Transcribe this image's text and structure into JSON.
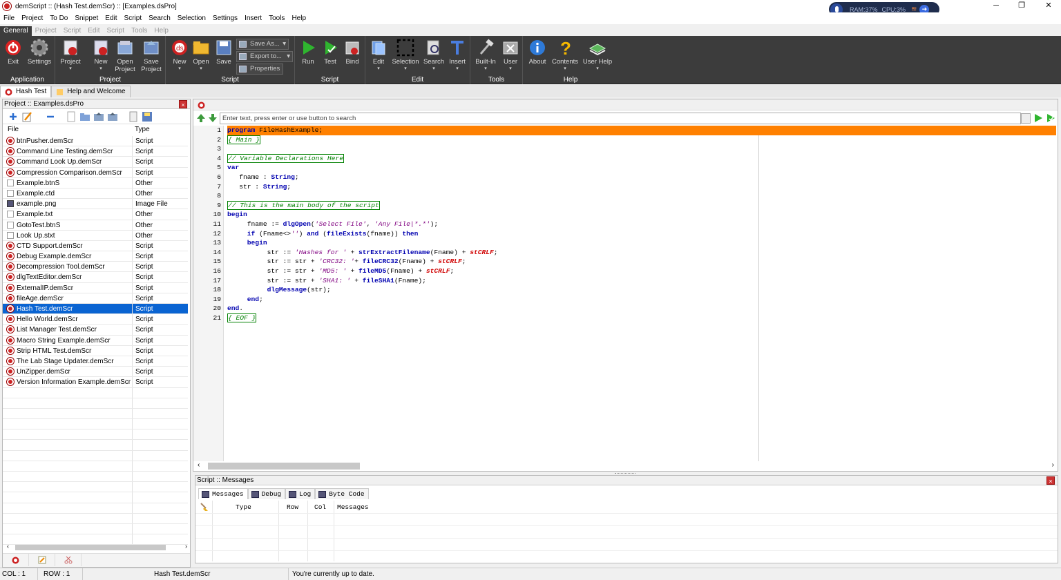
{
  "window": {
    "title": "demScript :: (Hash Test.demScr) :: [Examples.dsPro]",
    "minimize": "─",
    "maximize": "❐",
    "close": "✕"
  },
  "system_monitor": {
    "ram": "RAM:37%",
    "cpu": "CPU:3%"
  },
  "menu": [
    "File",
    "Project",
    "To Do",
    "Snippet",
    "Edit",
    "Script",
    "Search",
    "Selection",
    "Settings",
    "Insert",
    "Tools",
    "Help"
  ],
  "ribbon_tabs": [
    "General",
    "Project",
    "Script",
    "Edit",
    "Script",
    "Tools",
    "Help"
  ],
  "ribbon": {
    "application": {
      "label": "Application",
      "exit": "Exit",
      "settings": "Settings"
    },
    "project": {
      "label": "Project",
      "project": "Project"
    },
    "new": "New",
    "open_project_1": "Open",
    "open_project_2": "Project",
    "save_project_1": "Save",
    "save_project_2": "Project",
    "script": {
      "label": "Script",
      "new": "New",
      "open": "Open",
      "save": "Save",
      "save_as": "Save As...",
      "export": "Export to...",
      "properties": "Properties"
    },
    "script2": {
      "label": "Script",
      "run": "Run",
      "test": "Test",
      "bind": "Bind"
    },
    "edit": {
      "label": "Edit",
      "edit": "Edit",
      "selection": "Selection",
      "search": "Search",
      "insert": "Insert"
    },
    "tools": {
      "label": "Tools",
      "builtin": "Built-In",
      "user": "User"
    },
    "help": {
      "label": "Help",
      "about": "About",
      "contents": "Contents",
      "user_help": "User Help"
    }
  },
  "doc_tabs": [
    "Hash Test",
    "Help and Welcome"
  ],
  "project_panel": {
    "title": "Project :: Examples.dsPro",
    "columns": [
      "File",
      "Type"
    ],
    "files": [
      {
        "name": "btnPusher.demScr",
        "type": "Script",
        "icon": "script"
      },
      {
        "name": "Command Line Testing.demScr",
        "type": "Script",
        "icon": "script"
      },
      {
        "name": "Command Look Up.demScr",
        "type": "Script",
        "icon": "script"
      },
      {
        "name": "Compression Comparison.demScr",
        "type": "Script",
        "icon": "script"
      },
      {
        "name": "Example.btnS",
        "type": "Other",
        "icon": "other"
      },
      {
        "name": "Example.ctd",
        "type": "Other",
        "icon": "other"
      },
      {
        "name": "example.png",
        "type": "Image File",
        "icon": "image"
      },
      {
        "name": "Example.txt",
        "type": "Other",
        "icon": "other"
      },
      {
        "name": "GotoTest.btnS",
        "type": "Other",
        "icon": "other"
      },
      {
        "name": "Look Up.stxt",
        "type": "Other",
        "icon": "other"
      },
      {
        "name": "CTD Support.demScr",
        "type": "Script",
        "icon": "script"
      },
      {
        "name": "Debug Example.demScr",
        "type": "Script",
        "icon": "script"
      },
      {
        "name": "Decompression Tool.demScr",
        "type": "Script",
        "icon": "script"
      },
      {
        "name": "dlgTextEditor.demScr",
        "type": "Script",
        "icon": "script"
      },
      {
        "name": "ExternalIP.demScr",
        "type": "Script",
        "icon": "script"
      },
      {
        "name": "fileAge.demScr",
        "type": "Script",
        "icon": "script"
      },
      {
        "name": "Hash Test.demScr",
        "type": "Script",
        "icon": "script",
        "selected": true
      },
      {
        "name": "Hello World.demScr",
        "type": "Script",
        "icon": "script"
      },
      {
        "name": "List Manager Test.demScr",
        "type": "Script",
        "icon": "script"
      },
      {
        "name": "Macro String Example.demScr",
        "type": "Script",
        "icon": "script"
      },
      {
        "name": "Strip HTML Test.demScr",
        "type": "Script",
        "icon": "script"
      },
      {
        "name": "The Lab Stage Updater.demScr",
        "type": "Script",
        "icon": "script"
      },
      {
        "name": "UnZipper.demScr",
        "type": "Script",
        "icon": "script"
      },
      {
        "name": "Version Information Example.demScr",
        "type": "Script",
        "icon": "script"
      }
    ]
  },
  "editor": {
    "search_placeholder": "Enter text, press enter or use button to search",
    "lines": [
      [
        [
          "kw",
          "program"
        ],
        [
          "t",
          " FileHashExample;"
        ]
      ],
      [
        [
          "cm",
          "{ Main }"
        ]
      ],
      [],
      [
        [
          "cm",
          "// Variable Declarations Here"
        ]
      ],
      [
        [
          "kw",
          "var"
        ]
      ],
      [
        [
          "t",
          "   fname : "
        ],
        [
          "kw",
          "String"
        ],
        [
          "t",
          ";"
        ]
      ],
      [
        [
          "t",
          "   str : "
        ],
        [
          "kw",
          "String"
        ],
        [
          "t",
          ";"
        ]
      ],
      [],
      [
        [
          "cm",
          "// This is the main body of the script"
        ]
      ],
      [
        [
          "kw",
          "begin"
        ]
      ],
      [
        [
          "t",
          "     fname := "
        ],
        [
          "fn",
          "dlgOpen"
        ],
        [
          "t",
          "("
        ],
        [
          "str",
          "'Select File'"
        ],
        [
          "t",
          ", "
        ],
        [
          "str",
          "'Any File|*.*'"
        ],
        [
          "t",
          ");"
        ]
      ],
      [
        [
          "t",
          "     "
        ],
        [
          "kw",
          "if"
        ],
        [
          "t",
          " (Fname<>"
        ],
        [
          "str",
          "''"
        ],
        [
          "t",
          ") "
        ],
        [
          "kw",
          "and"
        ],
        [
          "t",
          " ("
        ],
        [
          "fn",
          "fileExists"
        ],
        [
          "t",
          "(fname)) "
        ],
        [
          "kw",
          "then"
        ]
      ],
      [
        [
          "t",
          "     "
        ],
        [
          "kw",
          "begin"
        ]
      ],
      [
        [
          "t",
          "          str := "
        ],
        [
          "str",
          "'Hashes for '"
        ],
        [
          "t",
          " + "
        ],
        [
          "fn",
          "strExtractFilename"
        ],
        [
          "t",
          "(Fname) + "
        ],
        [
          "cst",
          "stCRLF"
        ],
        [
          "t",
          ";"
        ]
      ],
      [
        [
          "t",
          "          str := str + "
        ],
        [
          "str",
          "'CRC32: '"
        ],
        [
          "t",
          "+ "
        ],
        [
          "fn",
          "fileCRC32"
        ],
        [
          "t",
          "(Fname) + "
        ],
        [
          "cst",
          "stCRLF"
        ],
        [
          "t",
          ";"
        ]
      ],
      [
        [
          "t",
          "          str := str + "
        ],
        [
          "str",
          "'MD5: '"
        ],
        [
          "t",
          " + "
        ],
        [
          "fn",
          "fileMD5"
        ],
        [
          "t",
          "(Fname) + "
        ],
        [
          "cst",
          "stCRLF"
        ],
        [
          "t",
          ";"
        ]
      ],
      [
        [
          "t",
          "          str := str + "
        ],
        [
          "str",
          "'SHA1: '"
        ],
        [
          "t",
          " + "
        ],
        [
          "fn",
          "fileSHA1"
        ],
        [
          "t",
          "(Fname);"
        ]
      ],
      [
        [
          "t",
          "          "
        ],
        [
          "fn",
          "dlgMessage"
        ],
        [
          "t",
          "(str);"
        ]
      ],
      [
        [
          "t",
          "     "
        ],
        [
          "kw",
          "end"
        ],
        [
          "t",
          ";"
        ]
      ],
      [
        [
          "kw",
          "end"
        ],
        [
          "t",
          "."
        ]
      ],
      [
        [
          "cm",
          "{ EOF }"
        ]
      ]
    ]
  },
  "messages_panel": {
    "title": "Script :: Messages",
    "tabs": [
      "Messages",
      "Debug",
      "Log",
      "Byte Code"
    ],
    "columns": [
      "Type",
      "Row",
      "Col",
      "Messages"
    ]
  },
  "status": {
    "col": "COL : 1",
    "row": "ROW : 1",
    "file": "Hash Test.demScr",
    "message": "You're currently up to date."
  },
  "colors": {
    "accent": "#0a64d2",
    "highlight_line": "#ff8000",
    "ribbon_bg": "#3c3c3c"
  }
}
